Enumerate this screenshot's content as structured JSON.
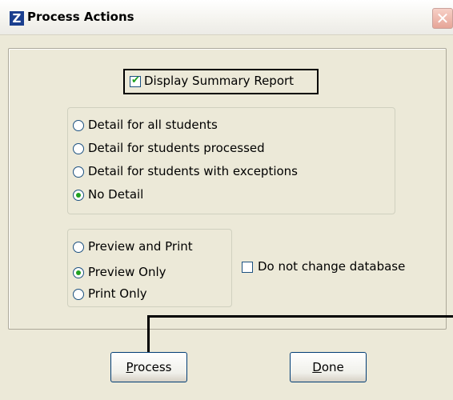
{
  "window": {
    "title": "Process Actions",
    "icon_letter": "Z",
    "close_symbol": "✕"
  },
  "summary": {
    "label": "Display Summary Report",
    "checked": true
  },
  "detail_options": {
    "items": [
      {
        "label": "Detail for all students",
        "selected": false
      },
      {
        "label": "Detail for students processed",
        "selected": false
      },
      {
        "label": "Detail for students with exceptions",
        "selected": false
      },
      {
        "label": "No Detail",
        "selected": true
      }
    ]
  },
  "output_options": {
    "items": [
      {
        "label": "Preview and Print",
        "selected": false
      },
      {
        "label": "Preview Only",
        "selected": true
      },
      {
        "label": "Print Only",
        "selected": false
      }
    ]
  },
  "database": {
    "label": "Do not change database",
    "checked": false
  },
  "buttons": {
    "process": {
      "mnemonic": "P",
      "rest": "rocess"
    },
    "done": {
      "mnemonic": "D",
      "rest": "one"
    }
  },
  "colors": {
    "accent_check": "#21a121",
    "title_icon_bg": "#1b3f8f",
    "close_bg": "#e6a597"
  }
}
